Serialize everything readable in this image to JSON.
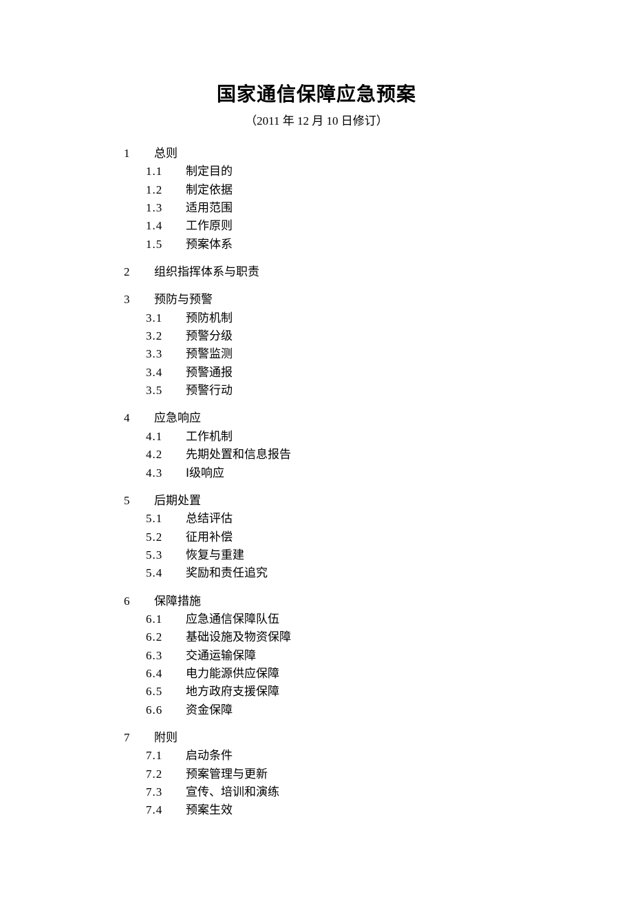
{
  "title": "国家通信保障应急预案",
  "subtitle": "（2011 年 12 月 10 日修订）",
  "sections": [
    {
      "num": "1",
      "title": "总则",
      "items": [
        {
          "num": "1.1",
          "title": "制定目的"
        },
        {
          "num": "1.2",
          "title": "制定依据"
        },
        {
          "num": "1.3",
          "title": "适用范围"
        },
        {
          "num": "1.4",
          "title": "工作原则"
        },
        {
          "num": "1.5",
          "title": "预案体系"
        }
      ]
    },
    {
      "num": "2",
      "title": "组织指挥体系与职责",
      "items": []
    },
    {
      "num": "3",
      "title": "预防与预警",
      "items": [
        {
          "num": "3.1",
          "title": "预防机制"
        },
        {
          "num": "3.2",
          "title": "预警分级"
        },
        {
          "num": "3.3",
          "title": "预警监测"
        },
        {
          "num": "3.4",
          "title": "预警通报"
        },
        {
          "num": "3.5",
          "title": "预警行动"
        }
      ]
    },
    {
      "num": "4",
      "title": "应急响应",
      "items": [
        {
          "num": "4.1",
          "title": "工作机制"
        },
        {
          "num": "4.2",
          "title": "先期处置和信息报告"
        },
        {
          "num": "4.3",
          "title": "Ⅰ级响应"
        }
      ]
    },
    {
      "num": "5",
      "title": "后期处置",
      "items": [
        {
          "num": "5.1",
          "title": "总结评估"
        },
        {
          "num": "5.2",
          "title": "征用补偿"
        },
        {
          "num": "5.3",
          "title": "恢复与重建"
        },
        {
          "num": "5.4",
          "title": "奖励和责任追究"
        }
      ]
    },
    {
      "num": "6",
      "title": "保障措施",
      "items": [
        {
          "num": "6.1",
          "title": "应急通信保障队伍"
        },
        {
          "num": "6.2",
          "title": "基础设施及物资保障"
        },
        {
          "num": "6.3",
          "title": "交通运输保障"
        },
        {
          "num": "6.4",
          "title": "电力能源供应保障"
        },
        {
          "num": "6.5",
          "title": "地方政府支援保障"
        },
        {
          "num": "6.6",
          "title": "资金保障"
        }
      ]
    },
    {
      "num": "7",
      "title": "附则",
      "items": [
        {
          "num": "7.1",
          "title": "启动条件"
        },
        {
          "num": "7.2",
          "title": "预案管理与更新"
        },
        {
          "num": "7.3",
          "title": "宣传、培训和演练"
        },
        {
          "num": "7.4",
          "title": "预案生效"
        }
      ]
    }
  ]
}
